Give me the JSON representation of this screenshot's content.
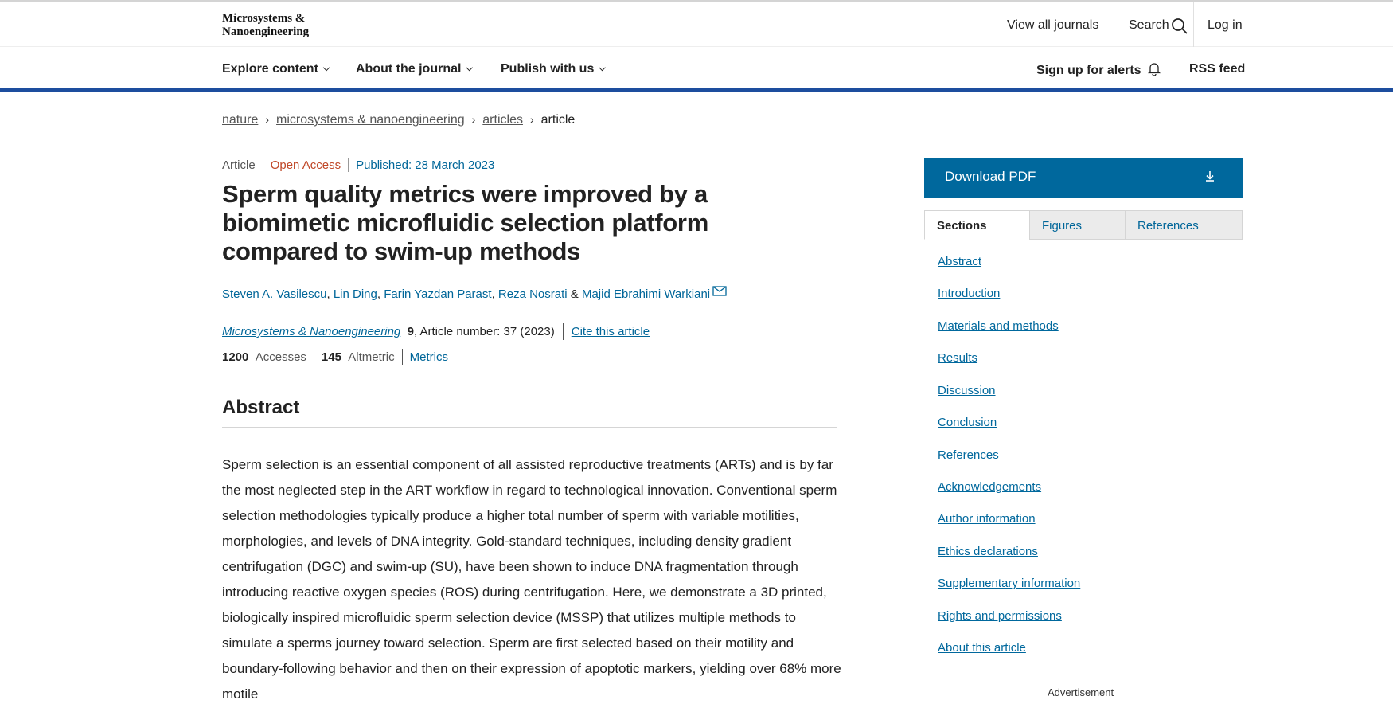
{
  "header": {
    "logo_line1": "Microsystems &",
    "logo_line2": "Nanoengineering",
    "view_all_journals": "View all journals",
    "search": "Search",
    "login": "Log in"
  },
  "nav": {
    "explore": "Explore content",
    "about": "About the journal",
    "publish": "Publish with us",
    "alerts": "Sign up for alerts",
    "rss": "RSS feed"
  },
  "breadcrumb": {
    "items": [
      "nature",
      "microsystems & nanoengineering",
      "articles"
    ],
    "current": "article"
  },
  "article": {
    "type": "Article",
    "access": "Open Access",
    "published": "Published: 28 March 2023",
    "title": "Sperm quality metrics were improved by a biomimetic microfluidic selection platform compared to swim-up methods",
    "authors": [
      "Steven A. Vasilescu",
      "Lin Ding",
      "Farin Yazdan Parast",
      "Reza Nosrati",
      "Majid Ebrahimi Warkiani"
    ],
    "author_and": "&",
    "journal": "Microsystems & Nanoengineering",
    "volume": "9",
    "article_number": ", Article number: 37 (2023)",
    "cite": "Cite this article",
    "accesses_count": "1200",
    "accesses_label": "Accesses",
    "altmetric_count": "145",
    "altmetric_label": "Altmetric",
    "metrics_link": "Metrics"
  },
  "abstract": {
    "heading": "Abstract",
    "text": "Sperm selection is an essential component of all assisted reproductive treatments (ARTs) and is by far the most neglected step in the ART workflow in regard to technological innovation. Conventional sperm selection methodologies typically produce a higher total number of sperm with variable motilities, morphologies, and levels of DNA integrity. Gold-standard techniques, including density gradient centrifugation (DGC) and swim-up (SU), have been shown to induce DNA fragmentation through introducing reactive oxygen species (ROS) during centrifugation. Here, we demonstrate a 3D printed, biologically inspired microfluidic sperm selection device (MSSP) that utilizes multiple methods to simulate a sperms journey toward selection. Sperm are first selected based on their motility and boundary-following behavior and then on their expression of apoptotic markers, yielding over 68% more motile"
  },
  "sidebar": {
    "download_pdf": "Download PDF",
    "tabs": [
      "Sections",
      "Figures",
      "References"
    ],
    "sections": [
      "Abstract",
      "Introduction",
      "Materials and methods",
      "Results",
      "Discussion",
      "Conclusion",
      "References",
      "Acknowledgements",
      "Author information",
      "Ethics declarations",
      "Supplementary information",
      "Rights and permissions",
      "About this article"
    ],
    "advertisement": "Advertisement"
  }
}
